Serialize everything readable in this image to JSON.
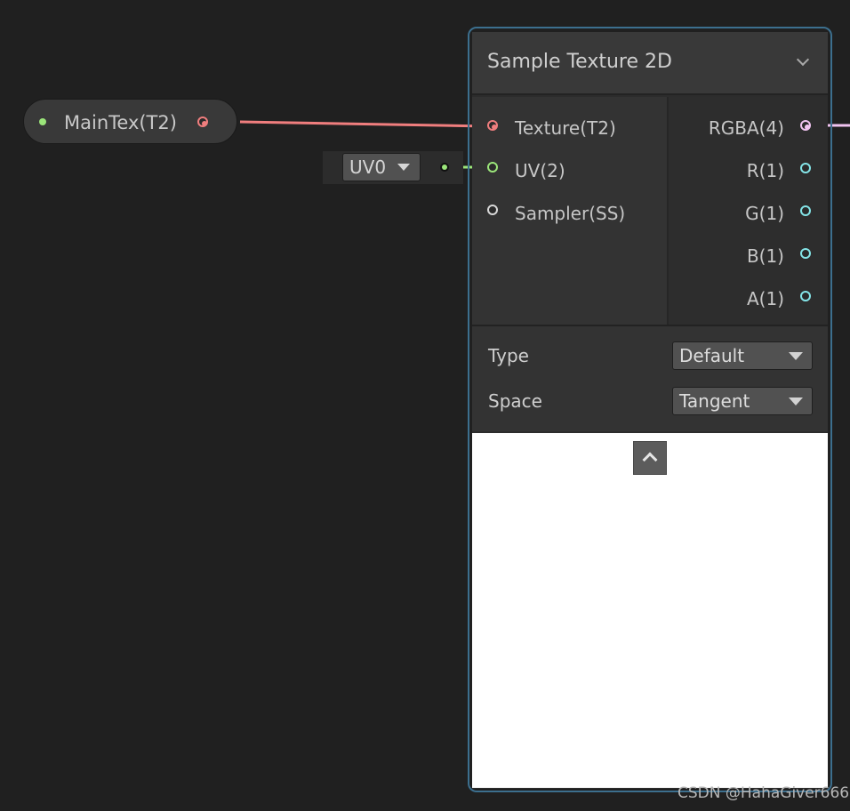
{
  "property_node": {
    "label": "MainTex(T2)",
    "dot_color": "#9be57a",
    "port_color": "#f07e7e"
  },
  "uv_input": {
    "value": "UV0",
    "port_color": "#9be57a"
  },
  "sample_texture_node": {
    "title": "Sample Texture 2D",
    "inputs": [
      {
        "label": "Texture(T2)",
        "port_color": "#f07e7e",
        "connected": true
      },
      {
        "label": "UV(2)",
        "port_color": "#9be57a",
        "connected": true
      },
      {
        "label": "Sampler(SS)",
        "port_color": "#d8d8d8",
        "connected": false
      }
    ],
    "outputs": [
      {
        "label": "RGBA(4)",
        "port_color": "#f1c4f1",
        "connected": true
      },
      {
        "label": "R(1)",
        "port_color": "#84e4e7",
        "connected": false
      },
      {
        "label": "G(1)",
        "port_color": "#84e4e7",
        "connected": false
      },
      {
        "label": "B(1)",
        "port_color": "#84e4e7",
        "connected": false
      },
      {
        "label": "A(1)",
        "port_color": "#84e4e7",
        "connected": false
      }
    ],
    "controls": {
      "type_label": "Type",
      "type_value": "Default",
      "space_label": "Space",
      "space_value": "Tangent"
    },
    "outline_color": "#3c6f8e"
  },
  "edges": {
    "texture_color": "#f07e7e",
    "uv_color": "#9be57a",
    "rgba_color": "#f1c4f1"
  },
  "icons": {
    "collapse": "chevron-down-icon",
    "preview_toggle": "chevron-up-icon"
  },
  "watermark": "CSDN @HahaGiver666"
}
